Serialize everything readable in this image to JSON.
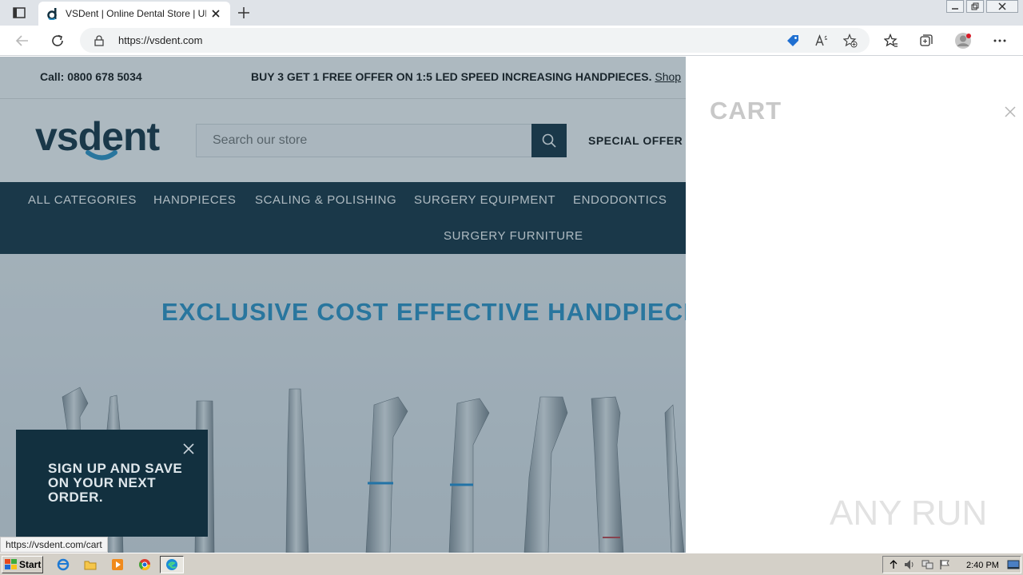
{
  "browser": {
    "tab_title": "VSDent | Online Dental Store | UK",
    "url": "https://vsdent.com",
    "status_url": "https://vsdent.com/cart"
  },
  "announcement": {
    "call": "Call: 0800 678 5034",
    "promo": "BUY 3 GET 1 FREE OFFER ON 1:5 LED SPEED INCREASING HANDPIECES.",
    "promo_link": "Shop"
  },
  "header": {
    "logo_text": "vsdent",
    "search_placeholder": "Search our store",
    "special_offers": "SPECIAL OFFER"
  },
  "nav": {
    "items": [
      "ALL CATEGORIES",
      "HANDPIECES",
      "SCALING & POLISHING",
      "SURGERY EQUIPMENT",
      "ENDODONTICS",
      "SURGERY FURNITURE"
    ]
  },
  "hero": {
    "title": "EXCLUSIVE COST EFFECTIVE HANDPIECES F"
  },
  "signup": {
    "text": "SIGN UP AND SAVE ON YOUR NEXT ORDER."
  },
  "cart": {
    "title": "CART"
  },
  "watermark": {
    "text": "ANY RUN"
  },
  "taskbar": {
    "start_label": "Start",
    "clock": "2:40 PM"
  },
  "colors": {
    "navy": "#12303f",
    "accent_blue": "#2b93c9"
  }
}
